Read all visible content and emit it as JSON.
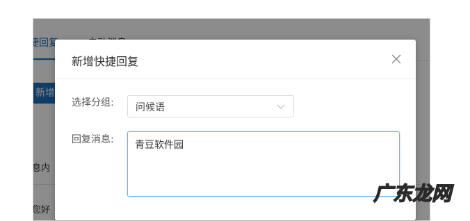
{
  "background": {
    "tabs": [
      {
        "label": "捷回复"
      },
      {
        "label": "自动消息"
      }
    ],
    "new_button_label": "新增",
    "column_label": "息内",
    "row_text": "您好"
  },
  "dialog": {
    "title": "新增快捷回复",
    "group_label": "选择分组:",
    "group_value": "问候语",
    "message_label": "回复消息:",
    "message_value": "青豆软件园"
  },
  "watermark": {
    "text": "广东龙网"
  },
  "colors": {
    "primary": "#1e6fb8",
    "focus_border": "#6fb3e6",
    "watermark": "#2a2a2a"
  }
}
